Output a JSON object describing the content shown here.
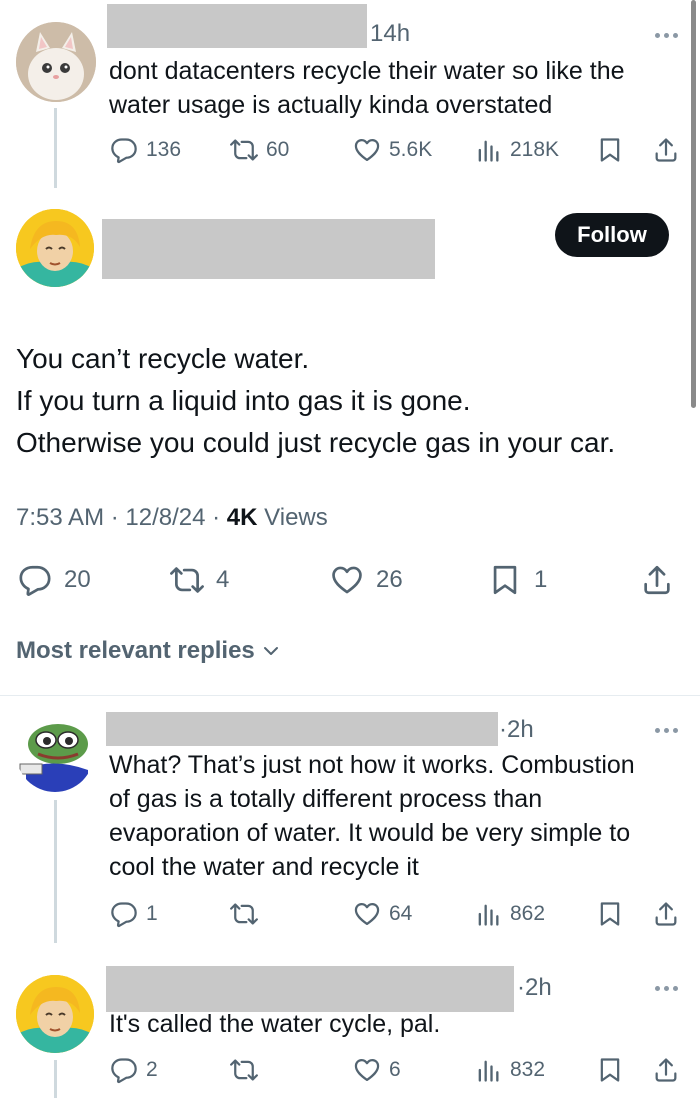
{
  "post1": {
    "time": "14h",
    "text_lines": [
      "dont datacenters recycle their water so like the",
      "water usage is actually kinda overstated"
    ],
    "replies": "136",
    "reposts": "60",
    "likes": "5.6K",
    "views": "218K"
  },
  "main": {
    "follow_label": "Follow",
    "text_lines": [
      "You can’t recycle water.",
      "If you turn a liquid into gas it is gone.",
      "Otherwise you could just recycle gas in your car."
    ],
    "time": "7:53 AM",
    "date": "12/8/24",
    "views_count": "4K",
    "views_label": "Views",
    "replies": "20",
    "reposts": "4",
    "likes": "26",
    "bookmarks": "1"
  },
  "sort_label": "Most relevant replies",
  "reply1": {
    "time": "2h",
    "text_lines": [
      "What? That’s just not how it works. Combustion",
      "of gas is a totally different process than",
      "evaporation of water. It would be very simple to",
      "cool the water and recycle it"
    ],
    "replies": "1",
    "reposts": "",
    "likes": "64",
    "views": "862"
  },
  "reply2": {
    "time": "2h",
    "text_lines": [
      "It's called the water cycle, pal."
    ],
    "replies": "2",
    "reposts": "",
    "likes": "6",
    "views": "832"
  },
  "colors": {
    "text": "#0f1419",
    "secondary": "#536471",
    "redacted": "#c8c8c8",
    "follow_bg": "#0f1419"
  },
  "icons": [
    "reply-icon",
    "repost-icon",
    "like-icon",
    "views-icon",
    "bookmark-icon",
    "share-icon",
    "more-icon",
    "chevron-down-icon"
  ]
}
